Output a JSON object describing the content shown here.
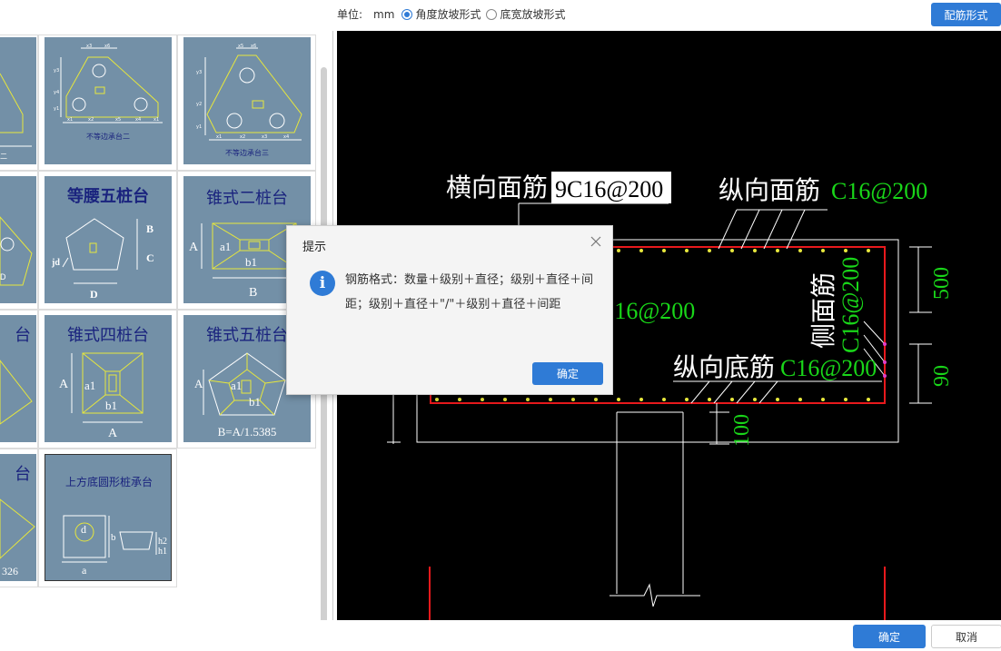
{
  "toolbar": {
    "unit_label": "单位:",
    "unit_value": "mm",
    "options": [
      {
        "label": "角度放坡形式",
        "selected": true
      },
      {
        "label": "底宽放坡形式",
        "selected": false
      }
    ],
    "rebar_form_button": "配筋形式"
  },
  "gallery": {
    "tiles": [
      {
        "id": "unequal-2",
        "caption": "不等边承台二",
        "labels": [
          "x3",
          "x6",
          "y3",
          "y4",
          "y1",
          "x1",
          "x2",
          "x5",
          "x4",
          "x1"
        ]
      },
      {
        "id": "unequal-3",
        "caption": "不等边承台三",
        "labels": [
          "x5",
          "x6",
          "y3",
          "y2",
          "y1",
          "x1",
          "x2",
          "x3",
          "x4"
        ]
      },
      {
        "id": "isosceles-5",
        "caption": "等腰五桩台",
        "labels": [
          "B",
          "C",
          "jd",
          "D"
        ]
      },
      {
        "id": "cone-2",
        "caption": "锥式二桩台",
        "labels": [
          "A",
          "a1",
          "b1",
          "B"
        ]
      },
      {
        "id": "cone-4",
        "caption": "锥式四桩台",
        "labels": [
          "A",
          "a1",
          "b1",
          "A"
        ]
      },
      {
        "id": "cone-5",
        "caption": "锥式五桩台",
        "labels": [
          "A",
          "a1",
          "b1",
          "B=A/1.5385"
        ]
      },
      {
        "id": "round-pile",
        "caption": "上方底圆形桩承台",
        "labels": [
          "d",
          "b",
          "a",
          "h2",
          "h1"
        ]
      }
    ],
    "partial_texts": [
      "台",
      "台",
      "台",
      "326"
    ]
  },
  "cad": {
    "transverse_top": {
      "name": "横向面筋",
      "value": "9C16@200"
    },
    "longitudinal_top": {
      "name": "纵向面筋",
      "value": "C16@200"
    },
    "middle_value": "C16@200",
    "side_bar": {
      "name": "侧面筋",
      "value": "C16@200"
    },
    "longitudinal_bottom": {
      "name": "纵向底筋",
      "value": "C16@200"
    },
    "dims": [
      "500",
      "90",
      "100"
    ]
  },
  "dialog": {
    "title": "提示",
    "icon": "info-icon",
    "message": "钢筋格式：数量＋级别＋直径；级别＋直径＋间距；级别＋直径＋\"/\"＋级别＋直径＋间距",
    "ok": "确定"
  },
  "footer": {
    "ok": "确定",
    "cancel": "取消"
  },
  "colors": {
    "accent": "#2f7bd6",
    "tile": "#7390a7",
    "cad_green": "#19d619",
    "cad_red": "#e8191c"
  }
}
